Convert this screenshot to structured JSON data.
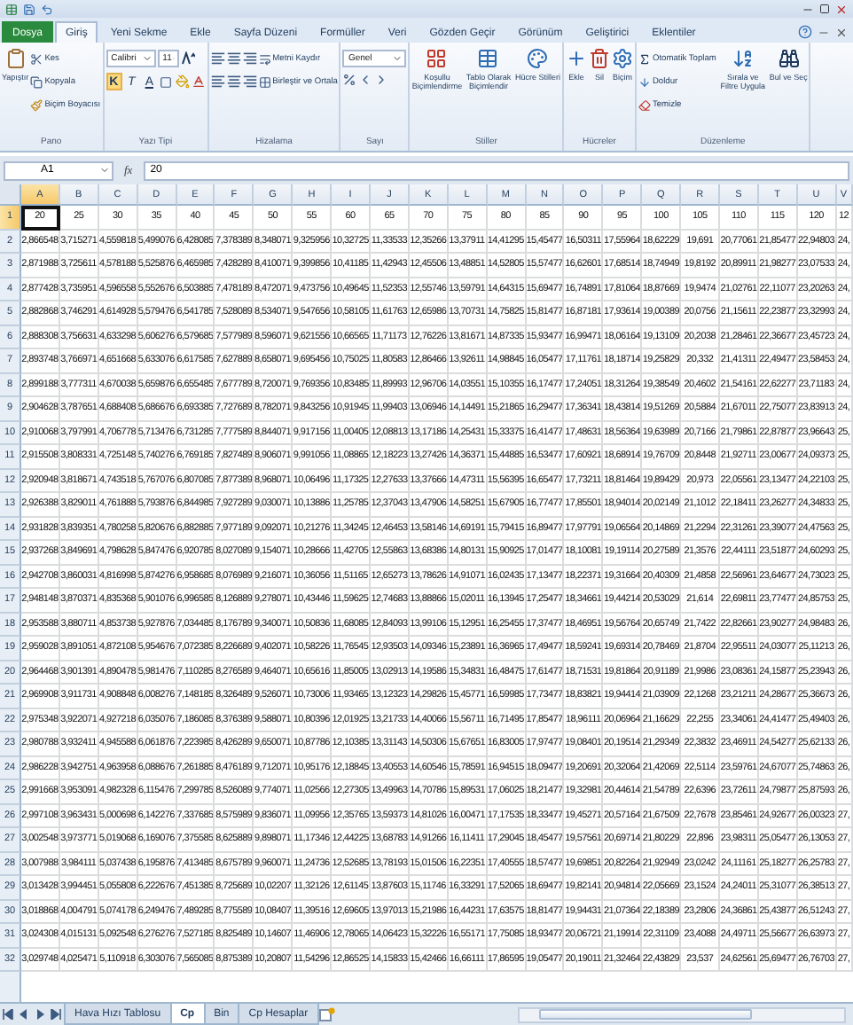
{
  "ribbon": {
    "tabs": [
      {
        "label": "Dosya",
        "kind": "file",
        "selected": false
      },
      {
        "label": "Giriş",
        "kind": "tab",
        "selected": true
      },
      {
        "label": "Yeni Sekme",
        "kind": "tab",
        "selected": false
      },
      {
        "label": "Ekle",
        "kind": "tab",
        "selected": false
      },
      {
        "label": "Sayfa Düzeni",
        "kind": "tab",
        "selected": false
      },
      {
        "label": "Formüller",
        "kind": "tab",
        "selected": false
      },
      {
        "label": "Veri",
        "kind": "tab",
        "selected": false
      },
      {
        "label": "Gözden Geçir",
        "kind": "tab",
        "selected": false
      },
      {
        "label": "Görünüm",
        "kind": "tab",
        "selected": false
      },
      {
        "label": "Geliştirici",
        "kind": "tab",
        "selected": false
      },
      {
        "label": "Eklentiler",
        "kind": "tab",
        "selected": false
      }
    ],
    "groups": [
      {
        "kind": "clipboard",
        "label": "Pano",
        "items": [
          {
            "kind": "large",
            "label": "Yapıştır"
          },
          {
            "kind": "small",
            "label": "Kes"
          },
          {
            "kind": "small",
            "label": "Kopyala"
          },
          {
            "kind": "small",
            "label": "Biçim Boyacısı"
          }
        ]
      },
      {
        "kind": "font",
        "label": "Yazı Tipi",
        "items": [
          {
            "kind": "field",
            "label": "Calibri"
          },
          {
            "kind": "field",
            "label": "11"
          },
          {
            "kind": "toggle",
            "label": "K",
            "selected": true
          },
          {
            "kind": "toggle",
            "label": "T",
            "selected": false
          },
          {
            "kind": "toggle",
            "label": "A",
            "selected": false
          }
        ]
      },
      {
        "kind": "alignment",
        "label": "Hizalama",
        "items": [
          {
            "kind": "small",
            "label": "Metni Kaydır"
          },
          {
            "kind": "small",
            "label": "Birleştir ve Ortala"
          }
        ]
      },
      {
        "kind": "number",
        "label": "Sayı",
        "items": [
          {
            "kind": "field",
            "label": "Genel"
          }
        ]
      },
      {
        "kind": "styles",
        "label": "Stiller",
        "items": [
          {
            "kind": "large",
            "label": "Koşullu Biçimlendirme"
          },
          {
            "kind": "large",
            "label": "Tablo Olarak Biçimlendir"
          },
          {
            "kind": "large",
            "label": "Hücre Stilleri"
          }
        ]
      },
      {
        "kind": "cells",
        "label": "Hücreler",
        "items": [
          {
            "kind": "large",
            "label": "Ekle"
          },
          {
            "kind": "large",
            "label": "Sil"
          },
          {
            "kind": "large",
            "label": "Biçim"
          }
        ]
      },
      {
        "kind": "editing",
        "label": "Düzenleme",
        "items": [
          {
            "kind": "small",
            "label": "Otomatik Toplam"
          },
          {
            "kind": "small",
            "label": "Doldur"
          },
          {
            "kind": "small",
            "label": "Temizle"
          },
          {
            "kind": "large",
            "label": "Sırala ve Filtre Uygula"
          },
          {
            "kind": "large",
            "label": "Bul ve Seç"
          }
        ]
      }
    ]
  },
  "formula_bar": {
    "name_box": "A1",
    "function_label": "fx",
    "value": "20"
  },
  "sheet": {
    "rows": [
      {
        "label": "1",
        "selected": true
      },
      {
        "label": "2",
        "selected": false
      },
      {
        "label": "3",
        "selected": false
      },
      {
        "label": "4",
        "selected": false
      },
      {
        "label": "5",
        "selected": false
      },
      {
        "label": "6",
        "selected": false
      },
      {
        "label": "7",
        "selected": false
      },
      {
        "label": "8",
        "selected": false
      },
      {
        "label": "9",
        "selected": false
      },
      {
        "label": "10",
        "selected": false
      },
      {
        "label": "11",
        "selected": false
      },
      {
        "label": "12",
        "selected": false
      },
      {
        "label": "13",
        "selected": false
      },
      {
        "label": "14",
        "selected": false
      },
      {
        "label": "15",
        "selected": false
      },
      {
        "label": "16",
        "selected": false
      },
      {
        "label": "17",
        "selected": false
      },
      {
        "label": "18",
        "selected": false
      },
      {
        "label": "19",
        "selected": false
      },
      {
        "label": "20",
        "selected": false
      },
      {
        "label": "21",
        "selected": false
      },
      {
        "label": "22",
        "selected": false
      },
      {
        "label": "23",
        "selected": false
      },
      {
        "label": "24",
        "selected": false
      },
      {
        "label": "25",
        "selected": false
      },
      {
        "label": "26",
        "selected": false
      },
      {
        "label": "27",
        "selected": false
      },
      {
        "label": "28",
        "selected": false
      },
      {
        "label": "29",
        "selected": false
      },
      {
        "label": "30",
        "selected": false
      },
      {
        "label": "31",
        "selected": false
      },
      {
        "label": "32",
        "selected": false
      }
    ],
    "columns": [
      {
        "letter": "A",
        "selected": true,
        "cells": [
          "20",
          "2,866548",
          "2,871988",
          "2,877428",
          "2,882868",
          "2,888308",
          "2,893748",
          "2,899188",
          "2,904628",
          "2,910068",
          "2,915508",
          "2,920948",
          "2,926388",
          "2,931828",
          "2,937268",
          "2,942708",
          "2,948148",
          "2,953588",
          "2,959028",
          "2,964468",
          "2,969908",
          "2,975348",
          "2,980788",
          "2,986228",
          "2,991668",
          "2,997108",
          "3,002548",
          "3,007988",
          "3,013428",
          "3,018868",
          "3,024308",
          "3,029748"
        ]
      },
      {
        "letter": "B",
        "selected": false,
        "cells": [
          "25",
          "3,715271",
          "3,725611",
          "3,735951",
          "3,746291",
          "3,756631",
          "3,766971",
          "3,777311",
          "3,787651",
          "3,797991",
          "3,808331",
          "3,818671",
          "3,829011",
          "3,839351",
          "3,849691",
          "3,860031",
          "3,870371",
          "3,880711",
          "3,891051",
          "3,901391",
          "3,911731",
          "3,922071",
          "3,932411",
          "3,942751",
          "3,953091",
          "3,963431",
          "3,973771",
          "3,984111",
          "3,994451",
          "4,004791",
          "4,015131",
          "4,025471"
        ]
      },
      {
        "letter": "C",
        "selected": false,
        "cells": [
          "30",
          "4,559818",
          "4,578188",
          "4,596558",
          "4,614928",
          "4,633298",
          "4,651668",
          "4,670038",
          "4,688408",
          "4,706778",
          "4,725148",
          "4,743518",
          "4,761888",
          "4,780258",
          "4,798628",
          "4,816998",
          "4,835368",
          "4,853738",
          "4,872108",
          "4,890478",
          "4,908848",
          "4,927218",
          "4,945588",
          "4,963958",
          "4,982328",
          "5,000698",
          "5,019068",
          "5,037438",
          "5,055808",
          "5,074178",
          "5,092548",
          "5,110918"
        ]
      },
      {
        "letter": "D",
        "selected": false,
        "cells": [
          "35",
          "5,499076",
          "5,525876",
          "5,552676",
          "5,579476",
          "5,606276",
          "5,633076",
          "5,659876",
          "5,686676",
          "5,713476",
          "5,740276",
          "5,767076",
          "5,793876",
          "5,820676",
          "5,847476",
          "5,874276",
          "5,901076",
          "5,927876",
          "5,954676",
          "5,981476",
          "6,008276",
          "6,035076",
          "6,061876",
          "6,088676",
          "6,115476",
          "6,142276",
          "6,169076",
          "6,195876",
          "6,222676",
          "6,249476",
          "6,276276",
          "6,303076"
        ]
      },
      {
        "letter": "E",
        "selected": false,
        "cells": [
          "40",
          "6,428085",
          "6,465985",
          "6,503885",
          "6,541785",
          "6,579685",
          "6,617585",
          "6,655485",
          "6,693385",
          "6,731285",
          "6,769185",
          "6,807085",
          "6,844985",
          "6,882885",
          "6,920785",
          "6,958685",
          "6,996585",
          "7,034485",
          "7,072385",
          "7,110285",
          "7,148185",
          "7,186085",
          "7,223985",
          "7,261885",
          "7,299785",
          "7,337685",
          "7,375585",
          "7,413485",
          "7,451385",
          "7,489285",
          "7,527185",
          "7,565085"
        ]
      },
      {
        "letter": "F",
        "selected": false,
        "cells": [
          "45",
          "7,378389",
          "7,428289",
          "7,478189",
          "7,528089",
          "7,577989",
          "7,627889",
          "7,677789",
          "7,727689",
          "7,777589",
          "7,827489",
          "7,877389",
          "7,927289",
          "7,977189",
          "8,027089",
          "8,076989",
          "8,126889",
          "8,176789",
          "8,226689",
          "8,276589",
          "8,326489",
          "8,376389",
          "8,426289",
          "8,476189",
          "8,526089",
          "8,575989",
          "8,625889",
          "8,675789",
          "8,725689",
          "8,775589",
          "8,825489",
          "8,875389"
        ]
      },
      {
        "letter": "G",
        "selected": false,
        "cells": [
          "50",
          "8,348071",
          "8,410071",
          "8,472071",
          "8,534071",
          "8,596071",
          "8,658071",
          "8,720071",
          "8,782071",
          "8,844071",
          "8,906071",
          "8,968071",
          "9,030071",
          "9,092071",
          "9,154071",
          "9,216071",
          "9,278071",
          "9,340071",
          "9,402071",
          "9,464071",
          "9,526071",
          "9,588071",
          "9,650071",
          "9,712071",
          "9,774071",
          "9,836071",
          "9,898071",
          "9,960071",
          "10,02207",
          "10,08407",
          "10,14607",
          "10,20807"
        ]
      },
      {
        "letter": "H",
        "selected": false,
        "cells": [
          "55",
          "9,325956",
          "9,399856",
          "9,473756",
          "9,547656",
          "9,621556",
          "9,695456",
          "9,769356",
          "9,843256",
          "9,917156",
          "9,991056",
          "10,06496",
          "10,13886",
          "10,21276",
          "10,28666",
          "10,36056",
          "10,43446",
          "10,50836",
          "10,58226",
          "10,65616",
          "10,73006",
          "10,80396",
          "10,87786",
          "10,95176",
          "11,02566",
          "11,09956",
          "11,17346",
          "11,24736",
          "11,32126",
          "11,39516",
          "11,46906",
          "11,54296"
        ]
      },
      {
        "letter": "I",
        "selected": false,
        "cells": [
          "60",
          "10,32725",
          "10,41185",
          "10,49645",
          "10,58105",
          "10,66565",
          "10,75025",
          "10,83485",
          "10,91945",
          "11,00405",
          "11,08865",
          "11,17325",
          "11,25785",
          "11,34245",
          "11,42705",
          "11,51165",
          "11,59625",
          "11,68085",
          "11,76545",
          "11,85005",
          "11,93465",
          "12,01925",
          "12,10385",
          "12,18845",
          "12,27305",
          "12,35765",
          "12,44225",
          "12,52685",
          "12,61145",
          "12,69605",
          "12,78065",
          "12,86525"
        ]
      },
      {
        "letter": "J",
        "selected": false,
        "cells": [
          "65",
          "11,33533",
          "11,42943",
          "11,52353",
          "11,61763",
          "11,71173",
          "11,80583",
          "11,89993",
          "11,99403",
          "12,08813",
          "12,18223",
          "12,27633",
          "12,37043",
          "12,46453",
          "12,55863",
          "12,65273",
          "12,74683",
          "12,84093",
          "12,93503",
          "13,02913",
          "13,12323",
          "13,21733",
          "13,31143",
          "13,40553",
          "13,49963",
          "13,59373",
          "13,68783",
          "13,78193",
          "13,87603",
          "13,97013",
          "14,06423",
          "14,15833"
        ]
      },
      {
        "letter": "K",
        "selected": false,
        "cells": [
          "70",
          "12,35266",
          "12,45506",
          "12,55746",
          "12,65986",
          "12,76226",
          "12,86466",
          "12,96706",
          "13,06946",
          "13,17186",
          "13,27426",
          "13,37666",
          "13,47906",
          "13,58146",
          "13,68386",
          "13,78626",
          "13,88866",
          "13,99106",
          "14,09346",
          "14,19586",
          "14,29826",
          "14,40066",
          "14,50306",
          "14,60546",
          "14,70786",
          "14,81026",
          "14,91266",
          "15,01506",
          "15,11746",
          "15,21986",
          "15,32226",
          "15,42466"
        ]
      },
      {
        "letter": "L",
        "selected": false,
        "cells": [
          "75",
          "13,37911",
          "13,48851",
          "13,59791",
          "13,70731",
          "13,81671",
          "13,92611",
          "14,03551",
          "14,14491",
          "14,25431",
          "14,36371",
          "14,47311",
          "14,58251",
          "14,69191",
          "14,80131",
          "14,91071",
          "15,02011",
          "15,12951",
          "15,23891",
          "15,34831",
          "15,45771",
          "15,56711",
          "15,67651",
          "15,78591",
          "15,89531",
          "16,00471",
          "16,11411",
          "16,22351",
          "16,33291",
          "16,44231",
          "16,55171",
          "16,66111"
        ]
      },
      {
        "letter": "M",
        "selected": false,
        "cells": [
          "80",
          "14,41295",
          "14,52805",
          "14,64315",
          "14,75825",
          "14,87335",
          "14,98845",
          "15,10355",
          "15,21865",
          "15,33375",
          "15,44885",
          "15,56395",
          "15,67905",
          "15,79415",
          "15,90925",
          "16,02435",
          "16,13945",
          "16,25455",
          "16,36965",
          "16,48475",
          "16,59985",
          "16,71495",
          "16,83005",
          "16,94515",
          "17,06025",
          "17,17535",
          "17,29045",
          "17,40555",
          "17,52065",
          "17,63575",
          "17,75085",
          "17,86595"
        ]
      },
      {
        "letter": "N",
        "selected": false,
        "cells": [
          "85",
          "15,45477",
          "15,57477",
          "15,69477",
          "15,81477",
          "15,93477",
          "16,05477",
          "16,17477",
          "16,29477",
          "16,41477",
          "16,53477",
          "16,65477",
          "16,77477",
          "16,89477",
          "17,01477",
          "17,13477",
          "17,25477",
          "17,37477",
          "17,49477",
          "17,61477",
          "17,73477",
          "17,85477",
          "17,97477",
          "18,09477",
          "18,21477",
          "18,33477",
          "18,45477",
          "18,57477",
          "18,69477",
          "18,81477",
          "18,93477",
          "19,05477"
        ]
      },
      {
        "letter": "O",
        "selected": false,
        "cells": [
          "90",
          "16,50311",
          "16,62601",
          "16,74891",
          "16,87181",
          "16,99471",
          "17,11761",
          "17,24051",
          "17,36341",
          "17,48631",
          "17,60921",
          "17,73211",
          "17,85501",
          "17,97791",
          "18,10081",
          "18,22371",
          "18,34661",
          "18,46951",
          "18,59241",
          "18,71531",
          "18,83821",
          "18,96111",
          "19,08401",
          "19,20691",
          "19,32981",
          "19,45271",
          "19,57561",
          "19,69851",
          "19,82141",
          "19,94431",
          "20,06721",
          "20,19011"
        ]
      },
      {
        "letter": "P",
        "selected": false,
        "cells": [
          "95",
          "17,55964",
          "17,68514",
          "17,81064",
          "17,93614",
          "18,06164",
          "18,18714",
          "18,31264",
          "18,43814",
          "18,56364",
          "18,68914",
          "18,81464",
          "18,94014",
          "19,06564",
          "19,19114",
          "19,31664",
          "19,44214",
          "19,56764",
          "19,69314",
          "19,81864",
          "19,94414",
          "20,06964",
          "20,19514",
          "20,32064",
          "20,44614",
          "20,57164",
          "20,69714",
          "20,82264",
          "20,94814",
          "21,07364",
          "21,19914",
          "21,32464"
        ]
      },
      {
        "letter": "Q",
        "selected": false,
        "cells": [
          "100",
          "18,62229",
          "18,74949",
          "18,87669",
          "19,00389",
          "19,13109",
          "19,25829",
          "19,38549",
          "19,51269",
          "19,63989",
          "19,76709",
          "19,89429",
          "20,02149",
          "20,14869",
          "20,27589",
          "20,40309",
          "20,53029",
          "20,65749",
          "20,78469",
          "20,91189",
          "21,03909",
          "21,16629",
          "21,29349",
          "21,42069",
          "21,54789",
          "21,67509",
          "21,80229",
          "21,92949",
          "22,05669",
          "22,18389",
          "22,31109",
          "22,43829"
        ]
      },
      {
        "letter": "R",
        "selected": false,
        "cells": [
          "105",
          "19,691",
          "19,8192",
          "19,9474",
          "20,0756",
          "20,2038",
          "20,332",
          "20,4602",
          "20,5884",
          "20,7166",
          "20,8448",
          "20,973",
          "21,1012",
          "21,2294",
          "21,3576",
          "21,4858",
          "21,614",
          "21,7422",
          "21,8704",
          "21,9986",
          "22,1268",
          "22,255",
          "22,3832",
          "22,5114",
          "22,6396",
          "22,7678",
          "22,896",
          "23,0242",
          "23,1524",
          "23,2806",
          "23,4088",
          "23,537"
        ]
      },
      {
        "letter": "S",
        "selected": false,
        "cells": [
          "110",
          "20,77061",
          "20,89911",
          "21,02761",
          "21,15611",
          "21,28461",
          "21,41311",
          "21,54161",
          "21,67011",
          "21,79861",
          "21,92711",
          "22,05561",
          "22,18411",
          "22,31261",
          "22,44111",
          "22,56961",
          "22,69811",
          "22,82661",
          "22,95511",
          "23,08361",
          "23,21211",
          "23,34061",
          "23,46911",
          "23,59761",
          "23,72611",
          "23,85461",
          "23,98311",
          "24,11161",
          "24,24011",
          "24,36861",
          "24,49711",
          "24,62561"
        ]
      },
      {
        "letter": "T",
        "selected": false,
        "cells": [
          "115",
          "21,85477",
          "21,98277",
          "22,11077",
          "22,23877",
          "22,36677",
          "22,49477",
          "22,62277",
          "22,75077",
          "22,87877",
          "23,00677",
          "23,13477",
          "23,26277",
          "23,39077",
          "23,51877",
          "23,64677",
          "23,77477",
          "23,90277",
          "24,03077",
          "24,15877",
          "24,28677",
          "24,41477",
          "24,54277",
          "24,67077",
          "24,79877",
          "24,92677",
          "25,05477",
          "25,18277",
          "25,31077",
          "25,43877",
          "25,56677",
          "25,69477"
        ]
      },
      {
        "letter": "U",
        "selected": false,
        "cells": [
          "120",
          "22,94803",
          "23,07533",
          "23,20263",
          "23,32993",
          "23,45723",
          "23,58453",
          "23,71183",
          "23,83913",
          "23,96643",
          "24,09373",
          "24,22103",
          "24,34833",
          "24,47563",
          "24,60293",
          "24,73023",
          "24,85753",
          "24,98483",
          "25,11213",
          "25,23943",
          "25,36673",
          "25,49403",
          "25,62133",
          "25,74863",
          "25,87593",
          "26,00323",
          "26,13053",
          "26,25783",
          "26,38513",
          "26,51243",
          "26,63973",
          "26,76703"
        ]
      },
      {
        "letter": "V",
        "selected": false,
        "cells": [
          "12",
          "24,",
          "24,",
          "24,",
          "24,",
          "24,",
          "24,",
          "24,",
          "24,",
          "25,",
          "25,",
          "25,",
          "25,",
          "25,",
          "25,",
          "25,",
          "25,",
          "26,",
          "26,",
          "26,",
          "26,",
          "26,",
          "26,",
          "26,",
          "26,",
          "27,",
          "27,",
          "27,",
          "27,",
          "27,",
          "27,",
          "27,"
        ]
      }
    ]
  },
  "sheet_tabs": [
    {
      "label": "Hava Hızı Tablosu",
      "selected": false
    },
    {
      "label": "Cp",
      "selected": true
    },
    {
      "label": "Bin",
      "selected": false
    },
    {
      "label": "Cp Hesaplar",
      "selected": false
    }
  ]
}
